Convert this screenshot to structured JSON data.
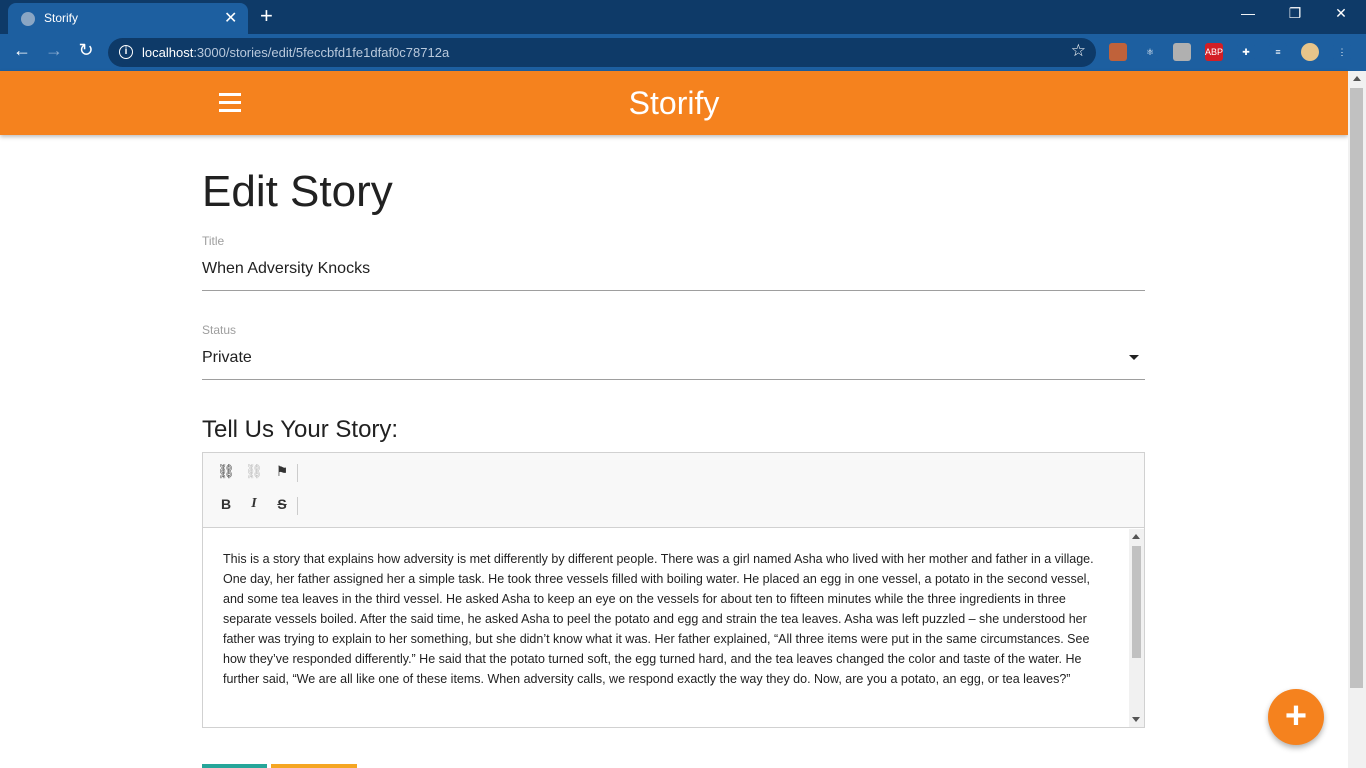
{
  "browser": {
    "tab_title": "Storify",
    "url_host": "localhost",
    "url_rest": ":3000/stories/edit/5feccbfd1fe1dfaf0c78712a",
    "new_tab": "+",
    "close_tab": "✕",
    "minimize": "—",
    "restore": "❐",
    "close_window": "✕",
    "back": "←",
    "forward": "→",
    "reload": "↻",
    "star": "☆",
    "extensions": [
      {
        "name": "image-extension-icon",
        "color": "#c0623a",
        "label": ""
      },
      {
        "name": "react-devtools-icon",
        "color": "#1d5fa0",
        "label": "⚛"
      },
      {
        "name": "gray-extension-icon",
        "color": "#b0b0b0",
        "label": ""
      },
      {
        "name": "adblock-plus-icon",
        "color": "#d31e25",
        "label": "ABP"
      },
      {
        "name": "puzzle-icon",
        "color": "#1d5fa0",
        "label": "✚"
      },
      {
        "name": "playlist-icon",
        "color": "#1d5fa0",
        "label": "≡"
      },
      {
        "name": "profile-avatar-icon",
        "color": "#e8c58a",
        "label": ""
      },
      {
        "name": "more-vert-icon",
        "color": "#1d5fa0",
        "label": "⋮"
      }
    ]
  },
  "app": {
    "brand": "Storify",
    "accent_color": "#f5821e"
  },
  "form": {
    "page_title": "Edit Story",
    "title_label": "Title",
    "title_value": "When Adversity Knocks",
    "status_label": "Status",
    "status_value": "Private",
    "story_heading": "Tell Us Your Story:",
    "story_body": "This is a story that explains how adversity is met differently by different people. There was a girl named Asha who lived with her mother and father in a village. One day, her father assigned her a simple task. He took three vessels filled with boiling water. He placed an egg in one vessel, a potato in the second vessel, and some tea leaves in the third vessel. He asked Asha to keep an eye on the vessels for about ten to fifteen minutes while the three ingredients in three separate vessels boiled. After the said time, he asked Asha to peel the potato and egg and strain the tea leaves. Asha was left puzzled – she understood her father was trying to explain to her something, but she didn’t know what it was. Her father explained, “All three items were put in the same circumstances. See how they’ve responded differently.” He said that the potato turned soft, the egg turned hard, and the tea leaves changed the color and taste of the water. He further said, “We are all like one of these items. When adversity calls, we respond exactly the way they do. Now, are you a potato, an egg, or tea leaves?”"
  },
  "editor_toolbar": {
    "link": "⛓",
    "unlink": "⛓",
    "anchor": "⚑",
    "bold": "B",
    "italic": "I",
    "strike": "S"
  },
  "fab": {
    "label": "+"
  }
}
